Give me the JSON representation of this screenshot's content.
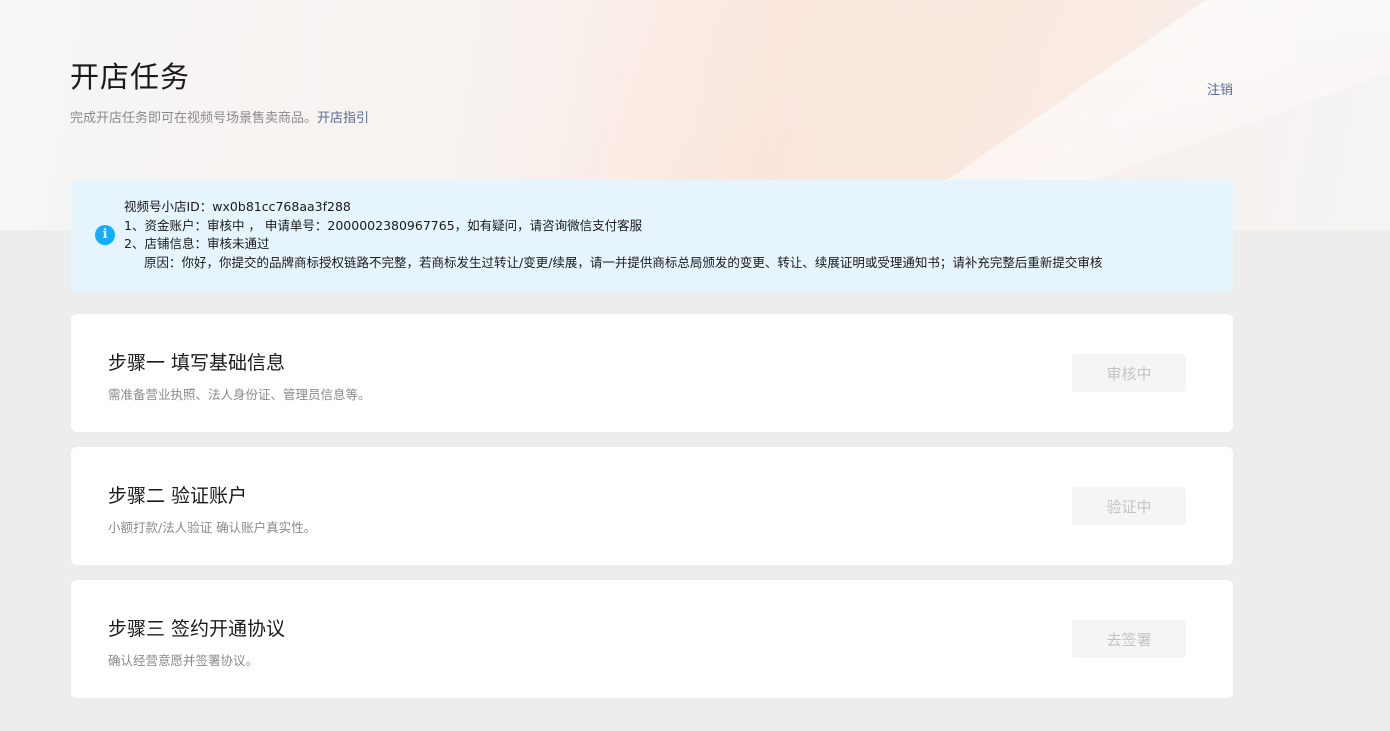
{
  "header": {
    "title": "开店任务",
    "subtitle": "完成开店任务即可在视频号场景售卖商品。",
    "guide_link": "开店指引",
    "logout": "注销"
  },
  "notice": {
    "icon": "info-icon",
    "lines": [
      "视频号小店ID：wx0b81cc768aa3f288",
      "1、资金账户：审核中 ， 申请单号：2000002380967765，如有疑问，请咨询微信支付客服",
      "2、店铺信息：审核未通过",
      "原因：你好，你提交的品牌商标授权链路不完整，若商标发生过转让/变更/续展，请一并提供商标总局颁发的变更、转让、续展证明或受理通知书；请补充完整后重新提交审核"
    ]
  },
  "steps": [
    {
      "title": "步骤一 填写基础信息",
      "desc": "需准备营业执照、法人身份证、管理员信息等。",
      "button": "审核中"
    },
    {
      "title": "步骤二 验证账户",
      "desc": "小额打款/法人验证 确认账户真实性。",
      "button": "验证中"
    },
    {
      "title": "步骤三 签约开通协议",
      "desc": "确认经营意愿并签署协议。",
      "button": "去签署"
    }
  ],
  "colors": {
    "accent_link": "#576b95",
    "info_blue": "#10aeff",
    "notice_bg": "#e6f4fd"
  }
}
